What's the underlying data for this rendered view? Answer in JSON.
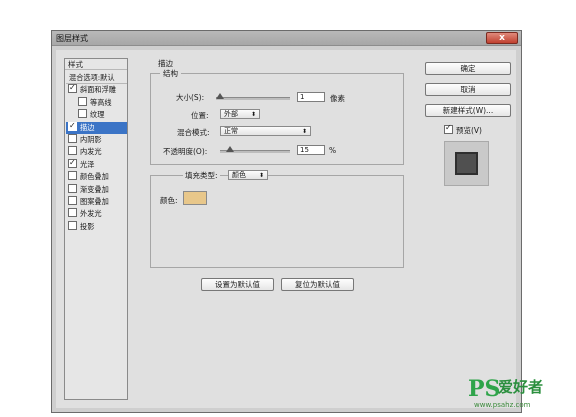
{
  "window": {
    "title": "图层样式",
    "close_glyph": "x"
  },
  "styles_panel": {
    "header": "样式",
    "items": [
      {
        "label": "混合选项:默认",
        "checkbox": false,
        "checked": false,
        "selected": false,
        "indent": false
      },
      {
        "label": "斜面和浮雕",
        "checkbox": true,
        "checked": true,
        "selected": false,
        "indent": false
      },
      {
        "label": "等高线",
        "checkbox": true,
        "checked": false,
        "selected": false,
        "indent": true
      },
      {
        "label": "纹理",
        "checkbox": true,
        "checked": false,
        "selected": false,
        "indent": true
      },
      {
        "label": "描边",
        "checkbox": true,
        "checked": true,
        "selected": true,
        "indent": false
      },
      {
        "label": "内阴影",
        "checkbox": true,
        "checked": false,
        "selected": false,
        "indent": false
      },
      {
        "label": "内发光",
        "checkbox": true,
        "checked": false,
        "selected": false,
        "indent": false
      },
      {
        "label": "光泽",
        "checkbox": true,
        "checked": true,
        "selected": false,
        "indent": false
      },
      {
        "label": "颜色叠加",
        "checkbox": true,
        "checked": false,
        "selected": false,
        "indent": false
      },
      {
        "label": "渐变叠加",
        "checkbox": true,
        "checked": false,
        "selected": false,
        "indent": false
      },
      {
        "label": "图案叠加",
        "checkbox": true,
        "checked": false,
        "selected": false,
        "indent": false
      },
      {
        "label": "外发光",
        "checkbox": true,
        "checked": false,
        "selected": false,
        "indent": false
      },
      {
        "label": "投影",
        "checkbox": true,
        "checked": false,
        "selected": false,
        "indent": false
      }
    ]
  },
  "stroke": {
    "section_title": "描边",
    "structure_title": "结构",
    "size_label": "大小(S):",
    "size_value": "1",
    "size_unit": "像素",
    "position_label": "位置:",
    "position_value": "外部",
    "blend_label": "混合模式:",
    "blend_value": "正常",
    "opacity_label": "不透明度(O):",
    "opacity_value": "15",
    "opacity_unit": "%",
    "fill_type_label": "填充类型:",
    "fill_type_value": "颜色",
    "color_label": "颜色:",
    "color_hex": "#e8c78a"
  },
  "bottom_buttons": {
    "set_default": "设置为默认值",
    "reset_default": "复位为默认值"
  },
  "right_buttons": {
    "ok": "确定",
    "cancel": "取消",
    "new_style": "新建样式(W)...",
    "preview": "预览(V)",
    "preview_checked": true
  },
  "watermark": {
    "logo": "PS",
    "text": "爱好者",
    "url": "www.psahz.com"
  }
}
